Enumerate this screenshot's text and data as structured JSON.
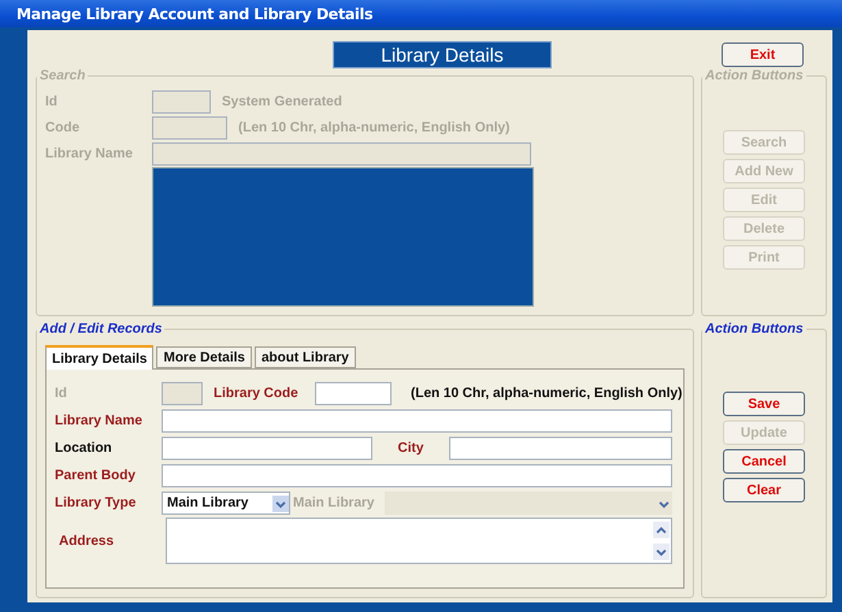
{
  "window": {
    "title": "Manage Library Account and Library Details"
  },
  "header": {
    "title": "Library Details"
  },
  "exit_button": {
    "label": "Exit",
    "disabled": false
  },
  "search": {
    "legend": "Search",
    "disabled": true,
    "fields": [
      {
        "kind": "short",
        "label": "Id",
        "hint": "System Generated"
      },
      {
        "kind": "code",
        "label": "Code",
        "hint": "(Len 10 Chr, alpha-numeric, English Only)"
      },
      {
        "kind": "long",
        "label": "Library Name"
      }
    ]
  },
  "search_actions": {
    "legend": "Action Buttons",
    "disabled": true,
    "buttons": [
      {
        "label": "Search",
        "disabled": true
      },
      {
        "label": "Add New",
        "disabled": true
      },
      {
        "label": "Edit",
        "disabled": true
      },
      {
        "label": "Delete",
        "disabled": true
      },
      {
        "label": "Print",
        "disabled": true
      }
    ]
  },
  "edit": {
    "legend": "Add / Edit Records",
    "tabs": [
      {
        "label": "Library Details",
        "selected": true
      },
      {
        "label": "More Details",
        "selected": false
      },
      {
        "label": "about Library",
        "selected": false
      }
    ],
    "form": {
      "id": {
        "label": "Id",
        "disabled": true
      },
      "library_code": {
        "label": "Library Code",
        "required": true
      },
      "code_hint": "(Len 10 Chr, alpha-numeric, English Only)",
      "library_name": {
        "label": "Library Name",
        "required": true
      },
      "location": {
        "label": "Location",
        "required": false
      },
      "city": {
        "label": "City",
        "required": true
      },
      "parent_body": {
        "label": "Parent Body",
        "required": true
      },
      "library_type": {
        "label": "Library Type",
        "required": true,
        "value": "Main Library"
      },
      "main_library": {
        "label": "Main Library",
        "disabled": true
      },
      "address": {
        "label": "Address",
        "required": true
      }
    }
  },
  "edit_actions": {
    "legend": "Action Buttons",
    "disabled": false,
    "buttons": [
      {
        "label": "Save",
        "disabled": false
      },
      {
        "label": "Update",
        "disabled": true
      },
      {
        "label": "Cancel",
        "disabled": false
      },
      {
        "label": "Clear",
        "disabled": false
      }
    ]
  }
}
